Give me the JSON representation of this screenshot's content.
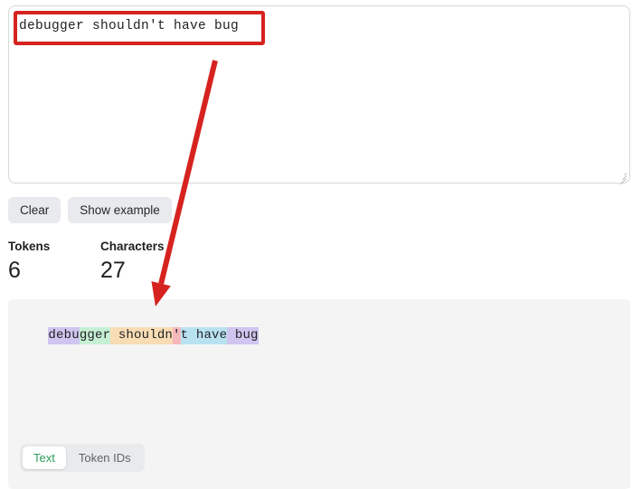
{
  "input": {
    "value": "debugger shouldn't have bug",
    "placeholder": "Enter some text"
  },
  "toolbar": {
    "clear_label": "Clear",
    "show_example_label": "Show example"
  },
  "stats": [
    {
      "label": "Tokens",
      "value": "6"
    },
    {
      "label": "Characters",
      "value": "27"
    }
  ],
  "output": {
    "tokens": [
      {
        "text": "debu",
        "color": "#cfc5ef"
      },
      {
        "text": "gger",
        "color": "#c6efd4"
      },
      {
        "text": " shouldn",
        "color": "#f8dcb4"
      },
      {
        "text": "'",
        "color": "#f5b8bd"
      },
      {
        "text": "t have",
        "color": "#b9e2f0"
      },
      {
        "text": " bug",
        "color": "#cfc5ef"
      }
    ]
  },
  "tabs": [
    {
      "label": "Text",
      "active": true
    },
    {
      "label": "Token IDs",
      "active": false
    }
  ],
  "annotation": {
    "highlight_color": "#d6231f",
    "arrow_color": "#d6231f",
    "arrow_start": "238,67",
    "arrow_end": "172,339"
  }
}
